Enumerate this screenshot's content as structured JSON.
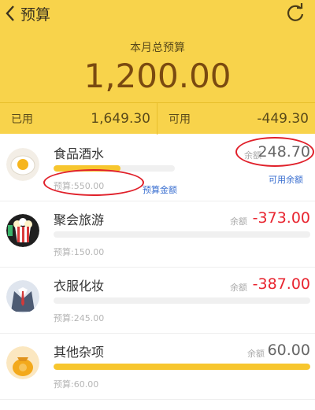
{
  "nav": {
    "title": "预算"
  },
  "summary": {
    "month_label": "本月总预算",
    "total": "1,200.00",
    "used_label": "已用",
    "used_value": "1,649.30",
    "available_label": "可用",
    "available_value": "-449.30"
  },
  "items": [
    {
      "name": "食品酒水",
      "remaining_label": "余额",
      "remaining": "248.70",
      "remaining_color": "#666666",
      "budget": "预算:550.00",
      "progress": 0.55,
      "icon": "fried-egg-icon"
    },
    {
      "name": "聚会旅游",
      "remaining_label": "余额",
      "remaining": "-373.00",
      "remaining_color": "#e8242f",
      "budget": "预算:150.00",
      "progress": 0,
      "icon": "popcorn-icon"
    },
    {
      "name": "衣服化妆",
      "remaining_label": "余额",
      "remaining": "-387.00",
      "remaining_color": "#e8242f",
      "budget": "预算:245.00",
      "progress": 0,
      "icon": "suit-icon"
    },
    {
      "name": "其他杂项",
      "remaining_label": "余额",
      "remaining": "60.00",
      "remaining_color": "#666666",
      "budget": "预算:60.00",
      "progress": 1.0,
      "icon": "money-bag-icon"
    }
  ],
  "annotations": {
    "budget_amount": "预算金额",
    "available_balance": "可用余额"
  },
  "colors": {
    "header": "#f8d34b",
    "bar": "#f7c62e",
    "negative": "#e8242f",
    "annotation": "#e0202a"
  }
}
